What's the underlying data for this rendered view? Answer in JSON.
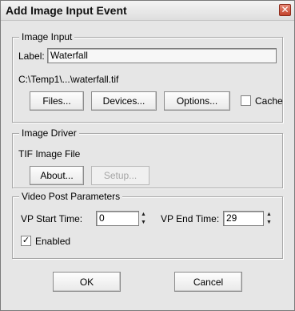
{
  "window": {
    "title": "Add Image Input Event",
    "close_glyph": "✕"
  },
  "image_input": {
    "legend": "Image Input",
    "label_caption": "Label:",
    "label_value": "Waterfall",
    "path": "C:\\Temp1\\...\\waterfall.tif",
    "files_label": "Files...",
    "devices_label": "Devices...",
    "options_label": "Options...",
    "cache_label": "Cache",
    "cache_checked": false
  },
  "image_driver": {
    "legend": "Image Driver",
    "driver_name": "TIF Image File",
    "about_label": "About...",
    "setup_label": "Setup..."
  },
  "video_post": {
    "legend": "Video Post Parameters",
    "start_label": "VP Start Time:",
    "start_value": "0",
    "end_label": "VP End Time:",
    "end_value": "29",
    "enabled_label": "Enabled",
    "enabled_mark": "✓"
  },
  "footer": {
    "ok_label": "OK",
    "cancel_label": "Cancel"
  },
  "icons": {
    "spinner_up": "▲",
    "spinner_down": "▼"
  }
}
